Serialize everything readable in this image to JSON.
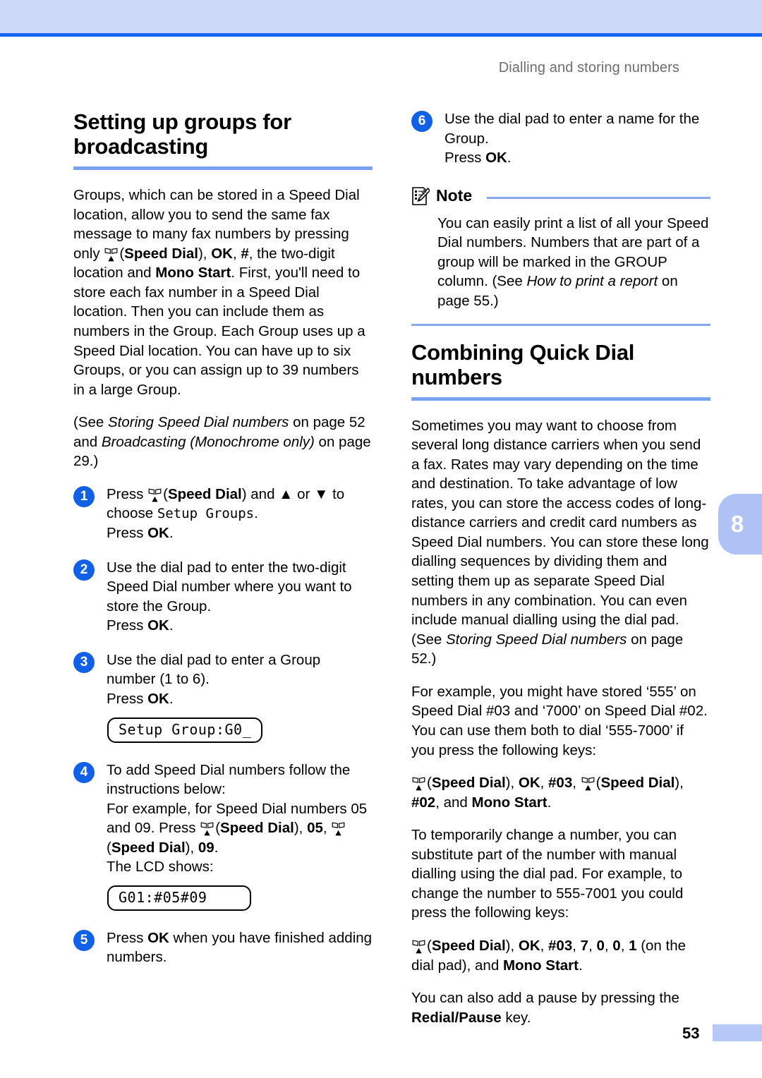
{
  "page": {
    "running_header": "Dialling and storing numbers",
    "chapter_tab": "8",
    "page_number": "53",
    "colors": {
      "banner": "#ccd8f7",
      "banner_rule": "#1565f5",
      "heading_rule": "#7aa0f0",
      "step_circle": "#1060e8",
      "note_rule": "#8aa9ec",
      "chapter_tab": "#aec2f5",
      "footer_bar": "#b6c8f7",
      "header_text": "#6d6d6d"
    }
  },
  "left_column": {
    "heading": "Setting up groups for broadcasting",
    "intro_p1_a": "Groups, which can be stored in a Speed Dial location, allow you to send the same fax message to many fax numbers by pressing only ",
    "intro_p1_speeddial": "Speed Dial",
    "intro_p1_b": ", ",
    "intro_p1_ok": "OK",
    "intro_p1_c": ", ",
    "intro_p1_hash": "#",
    "intro_p1_d": ", the two-digit location and ",
    "intro_p1_monostart": "Mono Start",
    "intro_p1_e": ". First, you'll need to store each fax number in a Speed Dial location. Then you can include them as numbers in the Group. Each Group uses up a Speed Dial location. You can have up to six Groups, or you can assign up to 39 numbers in a large Group.",
    "seealso_a": "(See ",
    "seealso_ital1": "Storing Speed Dial numbers",
    "seealso_b": " on page 52 and ",
    "seealso_ital2": "Broadcasting (Monochrome only)",
    "seealso_c": " on page 29.)",
    "steps": [
      {
        "num": "1",
        "a": "Press ",
        "sd": "Speed Dial",
        "b": " and ▲ or ▼ to choose ",
        "mono": "Setup Groups",
        "c": ".",
        "press_ok_pre": "Press ",
        "press_ok": "OK",
        "press_ok_post": "."
      },
      {
        "num": "2",
        "text": "Use the dial pad to enter the two-digit Speed Dial number where you want to store the Group.",
        "press_ok_pre": "Press ",
        "press_ok": "OK",
        "press_ok_post": "."
      },
      {
        "num": "3",
        "text": "Use the dial pad to enter a Group number (1 to 6).",
        "press_ok_pre": "Press ",
        "press_ok": "OK",
        "press_ok_post": ".",
        "lcd": "Setup Group:G0_"
      },
      {
        "num": "4",
        "a": "To add Speed Dial numbers follow the instructions below:",
        "b": "For example, for Speed Dial numbers 05 and 09. Press ",
        "sd1": "Speed Dial",
        "c": ", ",
        "n05": "05",
        "d": ", ",
        "sd2": "Speed Dial",
        "e": ", ",
        "n09": "09",
        "f": ".",
        "g": "The LCD shows:",
        "lcd": "G01:#05#09"
      },
      {
        "num": "5",
        "a": "Press ",
        "ok": "OK",
        "b": " when you have finished adding numbers."
      }
    ]
  },
  "right_column": {
    "step6": {
      "num": "6",
      "text": "Use the dial pad to enter a name for the Group.",
      "press_ok_pre": "Press ",
      "press_ok": "OK",
      "press_ok_post": "."
    },
    "note": {
      "label": "Note",
      "body_a": "You can easily print a list of all your Speed Dial numbers. Numbers that are part of a group will be marked in the GROUP column. (See ",
      "body_ital": "How to print a report",
      "body_b": " on page 55.)"
    },
    "heading": "Combining Quick Dial numbers",
    "p1_a": "Sometimes you may want to choose from several long distance carriers when you send a fax. Rates may vary depending on the time and destination. To take advantage of low rates, you can store the access codes of long-distance carriers and credit card numbers as Speed Dial numbers. You can store these long dialling sequences by dividing them and setting them up as separate Speed Dial numbers in any combination. You can even include manual dialling using the dial pad. (See ",
    "p1_ital": "Storing Speed Dial numbers",
    "p1_b": " on page 52.)",
    "p2": "For example, you might have stored ‘555’ on Speed Dial #03 and ‘7000’ on Speed Dial #02. You can use them both to dial ‘555-7000’ if you press the following keys:",
    "keys1": {
      "sd1": "Speed Dial",
      "a": ", ",
      "ok": "OK",
      "b": ", ",
      "h03": "#03",
      "c": ", ",
      "sd2": "Speed Dial",
      "d": ", ",
      "h02": "#02",
      "e": ", and ",
      "mono": "Mono Start",
      "f": "."
    },
    "p3": "To temporarily change a number, you can substitute part of the number with manual dialling using the dial pad. For example, to change the number to 555-7001 you could press the following keys:",
    "keys2": {
      "sd1": "Speed Dial",
      "a": ", ",
      "ok": "OK",
      "b": ", ",
      "h03": "#03",
      "c": ", ",
      "n7": "7",
      "d": ", ",
      "n0a": "0",
      "e": ", ",
      "n0b": "0",
      "f": ", ",
      "n1": "1",
      "g": " (on the dial pad), and ",
      "mono": "Mono Start",
      "h": "."
    },
    "p4_a": "You can also add a pause by pressing the ",
    "p4_bold": "Redial/Pause",
    "p4_b": " key."
  }
}
